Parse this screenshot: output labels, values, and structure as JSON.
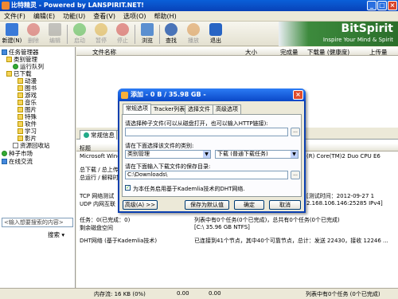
{
  "window": {
    "title": "比特精灵 - Powered by LANSPIRIT.NET!",
    "minimize": "_",
    "maximize": "□",
    "close": "×"
  },
  "menu": [
    "文件(F)",
    "编辑(E)",
    "功能(U)",
    "查看(V)",
    "选项(O)",
    "帮助(H)"
  ],
  "toolbar": {
    "new": "新建(N)",
    "delete": "删除",
    "edit": "编辑",
    "start": "启动",
    "pause": "暂停",
    "stop": "停止",
    "browse": "浏览",
    "find": "查找",
    "bookmark": "播放",
    "exit": "退出"
  },
  "logo": {
    "brand": "BitSpirit",
    "slogan": "Inspire Your Mind & Spirit"
  },
  "tree": {
    "root": "任务管理器",
    "category": "类别管理",
    "running": "运行队列",
    "downloaded": "已下载",
    "anime": "动漫",
    "books": "图书",
    "games": "游戏",
    "music": "音乐",
    "pictures": "图片",
    "special": "特殊",
    "software": "软件",
    "study": "学习",
    "movies": "影片",
    "recycle": "资源回收站",
    "torrent_market": "种子市场",
    "online_chat": "在线交流"
  },
  "search": {
    "placeholder": "<输入想要搜索的内容>",
    "button": "搜索 ▾"
  },
  "list_columns": {
    "filename": "文件名称",
    "size": "大小",
    "completed": "完成量",
    "download": "下载量 (健康度)",
    "upload": "上传量"
  },
  "bottom_tabs": {
    "general": "常规信息",
    "info": "信"
  },
  "info_header": {
    "title": "标题"
  },
  "info_lines": {
    "os": "Microsoft Window",
    "total_label": "总下载 / 总上传",
    "sub_label": "总运行 / 解释时间",
    "cpu": "(R) Core(TM)2 Duo CPU E6",
    "test_time": "[测试时间：2012-09-27 1",
    "ip": "2.168.106.146:25285 IPv4]",
    "tcp": "TCP 网络测试",
    "udp": "UDP 内网互联",
    "tasks": "任务：0(已完成：0)",
    "tasks_right": "列表中有0个任务(0个已完成)，总共有0个任务(0个已完成)",
    "remain": "剩余磁盘空间",
    "disk": "[C:\\ 35.96 GB NTFS]",
    "dht": "DHT网络 (基于Kademlia技术)",
    "dht_right": "已连接到41个节点，其中40个可靠节点，总计：发送 22430，接收 12246 ..."
  },
  "status": {
    "memory": "内存流: 16 KB (0%)",
    "zero1": "0.00",
    "zero2": "0.00",
    "tasks": "列表中有0个任务 (0个已完成)"
  },
  "dialog": {
    "title": "添加 - 0 B / 35.98 GB -",
    "close": "×",
    "tabs": [
      "常规选项",
      "Tracker列表",
      "选择文件",
      "高级选项"
    ],
    "torrent_label": "请选择种子文件(可以从磁盘打开，也可以输入HTTP链接):",
    "torrent_value": "",
    "browse_btn": "...",
    "category_label": "请在下面选择该文件的类别:",
    "category_value": "类别管理",
    "mode_value": "下载 (普通下载任务)",
    "save_label": "请在下面输入下载文件的保存目录:",
    "save_value": "C:\\Downloads\\",
    "kademlia": "为本任务启用基于Kademlia技术的DHT网络.",
    "kademlia_check": "✓",
    "btn_advanced": "高级(A) >>",
    "btn_save_default": "保存为默认值",
    "btn_ok": "确定",
    "btn_cancel": "取消"
  },
  "colors": {
    "titlebar": "#0a5fd8",
    "dialog_title": "#2c7cf5",
    "logo_green": "#3d8a3d"
  }
}
